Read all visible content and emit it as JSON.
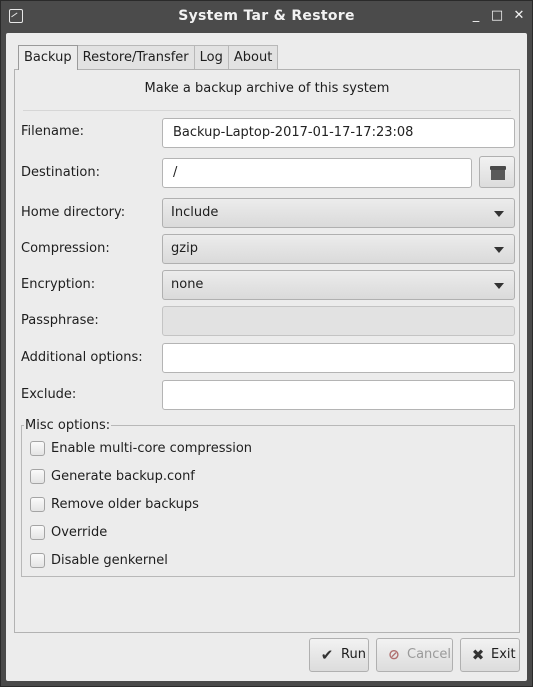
{
  "window": {
    "title": "System Tar & Restore"
  },
  "titlebar": {
    "minimize_glyph": "_",
    "maximize_glyph": "□",
    "close_glyph": "✕"
  },
  "tabs": [
    {
      "label": "Backup",
      "active": true
    },
    {
      "label": "Restore/Transfer",
      "active": false
    },
    {
      "label": "Log",
      "active": false
    },
    {
      "label": "About",
      "active": false
    }
  ],
  "backup": {
    "heading": "Make a backup archive of this system",
    "filename": {
      "label": "Filename:",
      "value": "Backup-Laptop-2017-01-17-17:23:08"
    },
    "destination": {
      "label": "Destination:",
      "value": "/"
    },
    "home_directory": {
      "label": "Home directory:",
      "value": "Include"
    },
    "compression": {
      "label": "Compression:",
      "value": "gzip"
    },
    "encryption": {
      "label": "Encryption:",
      "value": "none"
    },
    "passphrase": {
      "label": "Passphrase:",
      "value": ""
    },
    "additional_options": {
      "label": "Additional options:",
      "value": ""
    },
    "exclude": {
      "label": "Exclude:",
      "value": ""
    },
    "misc": {
      "title": "Misc options:",
      "options": [
        {
          "label": "Enable multi-core compression",
          "checked": false
        },
        {
          "label": "Generate backup.conf",
          "checked": false
        },
        {
          "label": "Remove older backups",
          "checked": false
        },
        {
          "label": "Override",
          "checked": false
        },
        {
          "label": "Disable genkernel",
          "checked": false
        }
      ]
    }
  },
  "buttons": {
    "run": {
      "label": "Run",
      "icon": "check-icon"
    },
    "cancel": {
      "label": "Cancel",
      "icon": "cancel-icon",
      "disabled": true
    },
    "exit": {
      "label": "Exit",
      "icon": "close-icon"
    }
  },
  "icons": {
    "browse": "folder-icon"
  }
}
